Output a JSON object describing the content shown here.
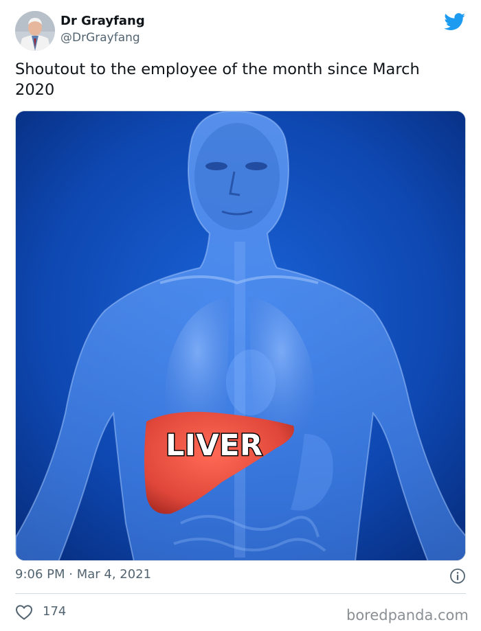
{
  "tweet": {
    "author_name": "Dr Grayfang",
    "author_handle": "@DrGrayfang",
    "text": "Shoutout to the employee of the month since March 2020",
    "timestamp": "9:06 PM · Mar 4, 2021",
    "like_count": "174",
    "media": {
      "overlay_label": "LIVER"
    }
  },
  "watermark": "boredpanda.com",
  "icons": {
    "brand": "twitter-bird-icon",
    "info": "info-icon",
    "like": "heart-icon"
  },
  "colors": {
    "brand": "#1d9bf0",
    "text": "#0f1419",
    "muted": "#536471",
    "liver": "#e0473a",
    "media_bg": "#0a3ea0"
  }
}
